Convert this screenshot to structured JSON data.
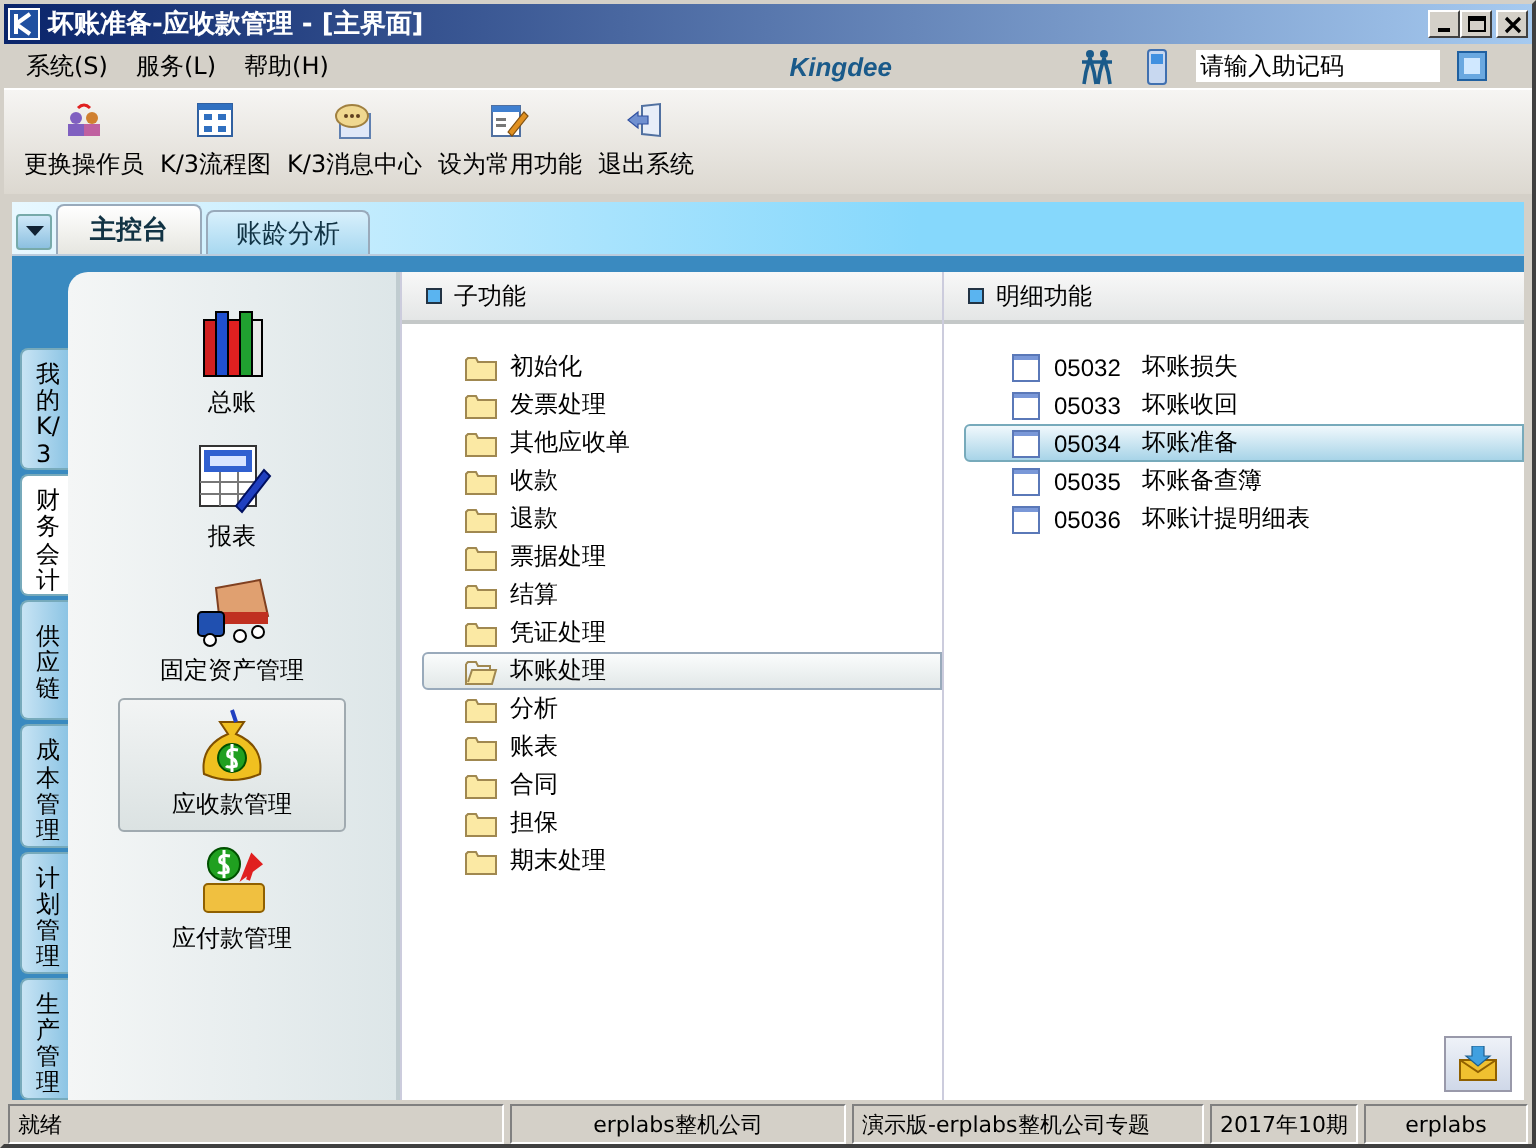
{
  "window": {
    "title": "坏账准备-应收款管理 - [主界面]"
  },
  "menu": [
    {
      "label": "系统(S)"
    },
    {
      "label": "服务(L)"
    },
    {
      "label": "帮助(H)"
    }
  ],
  "brand": {
    "logo": "Kingdee"
  },
  "search": {
    "placeholder": "请输入助记码"
  },
  "toolbar": [
    {
      "label": "更换操作员",
      "kind": "users"
    },
    {
      "label": "K/3流程图",
      "kind": "flow"
    },
    {
      "label": "K/3消息中心",
      "kind": "message"
    },
    {
      "label": "设为常用功能",
      "kind": "edit"
    },
    {
      "label": "退出系统",
      "kind": "exit"
    }
  ],
  "tabs": [
    {
      "label": "主控台",
      "selected": true
    },
    {
      "label": "账龄分析",
      "selected": false
    }
  ],
  "side_tabs": [
    {
      "label": "我的K/3",
      "selected": false
    },
    {
      "label": "财务会计",
      "selected": true
    },
    {
      "label": "供应链",
      "selected": false
    },
    {
      "label": "成本管理",
      "selected": false
    },
    {
      "label": "计划管理",
      "selected": false
    },
    {
      "label": "生产管理",
      "selected": false
    }
  ],
  "modules": [
    {
      "label": "总账",
      "kind": "books",
      "selected": false
    },
    {
      "label": "报表",
      "kind": "report",
      "selected": false
    },
    {
      "label": "固定资产管理",
      "kind": "truck",
      "selected": false
    },
    {
      "label": "应收款管理",
      "kind": "moneybag",
      "selected": true
    },
    {
      "label": "应付款管理",
      "kind": "payment",
      "selected": false
    }
  ],
  "subfunctions": {
    "title": "子功能",
    "items": [
      {
        "label": "初始化",
        "selected": false
      },
      {
        "label": "发票处理",
        "selected": false
      },
      {
        "label": "其他应收单",
        "selected": false
      },
      {
        "label": "收款",
        "selected": false
      },
      {
        "label": "退款",
        "selected": false
      },
      {
        "label": "票据处理",
        "selected": false
      },
      {
        "label": "结算",
        "selected": false
      },
      {
        "label": "凭证处理",
        "selected": false
      },
      {
        "label": "坏账处理",
        "selected": true
      },
      {
        "label": "分析",
        "selected": false
      },
      {
        "label": "账表",
        "selected": false
      },
      {
        "label": "合同",
        "selected": false
      },
      {
        "label": "担保",
        "selected": false
      },
      {
        "label": "期末处理",
        "selected": false
      }
    ]
  },
  "details": {
    "title": "明细功能",
    "items": [
      {
        "code": "05032",
        "label": "坏账损失",
        "selected": false
      },
      {
        "code": "05033",
        "label": "坏账收回",
        "selected": false
      },
      {
        "code": "05034",
        "label": "坏账准备",
        "selected": true
      },
      {
        "code": "05035",
        "label": "坏账备查簿",
        "selected": false
      },
      {
        "code": "05036",
        "label": "坏账计提明细表",
        "selected": false
      }
    ]
  },
  "status_bar": [
    "就绪",
    "erplabs整机公司",
    "演示版-erplabs整机公司专题",
    "2017年10期",
    "erplabs"
  ]
}
